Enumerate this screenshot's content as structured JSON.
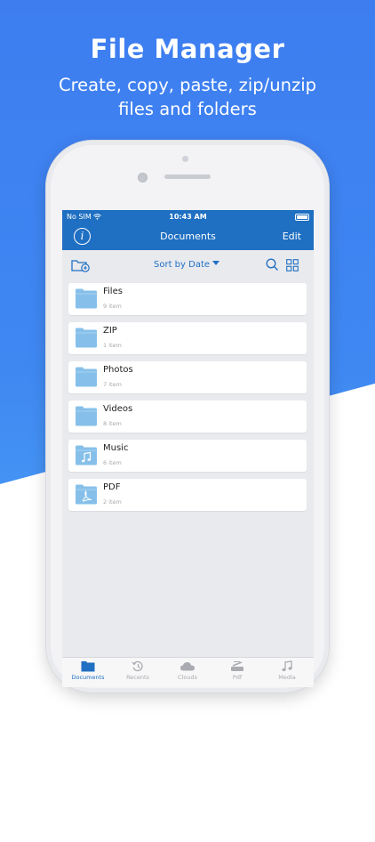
{
  "promo": {
    "headline": "File Manager",
    "subhead_line1": "Create, copy, paste, zip/unzip",
    "subhead_line2": "files and folders"
  },
  "status_bar": {
    "carrier": "No SIM",
    "time": "10:43 AM"
  },
  "nav": {
    "title": "Documents",
    "edit_label": "Edit"
  },
  "toolbar": {
    "sort_label": "Sort by Date"
  },
  "items": [
    {
      "name": "Files",
      "count": "9 item",
      "icon": "folder-icon"
    },
    {
      "name": "ZIP",
      "count": "1 item",
      "icon": "folder-icon"
    },
    {
      "name": "Photos",
      "count": "7 item",
      "icon": "folder-icon"
    },
    {
      "name": "Videos",
      "count": "8 item",
      "icon": "folder-icon"
    },
    {
      "name": "Music",
      "count": "6 item",
      "icon": "music-folder-icon"
    },
    {
      "name": "PDF",
      "count": "2 item",
      "icon": "pdf-folder-icon"
    }
  ],
  "tabs": [
    {
      "label": "Documents",
      "icon": "folder-icon",
      "active": true
    },
    {
      "label": "Recents",
      "icon": "history-icon"
    },
    {
      "label": "Clouds",
      "icon": "cloud-icon"
    },
    {
      "label": "Pdf",
      "icon": "scanner-icon"
    },
    {
      "label": "Media",
      "icon": "music-note-icon"
    }
  ],
  "colors": {
    "accent": "#1f6fc2",
    "folder": "#86c0ea",
    "background_blue": "#3d7df0"
  }
}
